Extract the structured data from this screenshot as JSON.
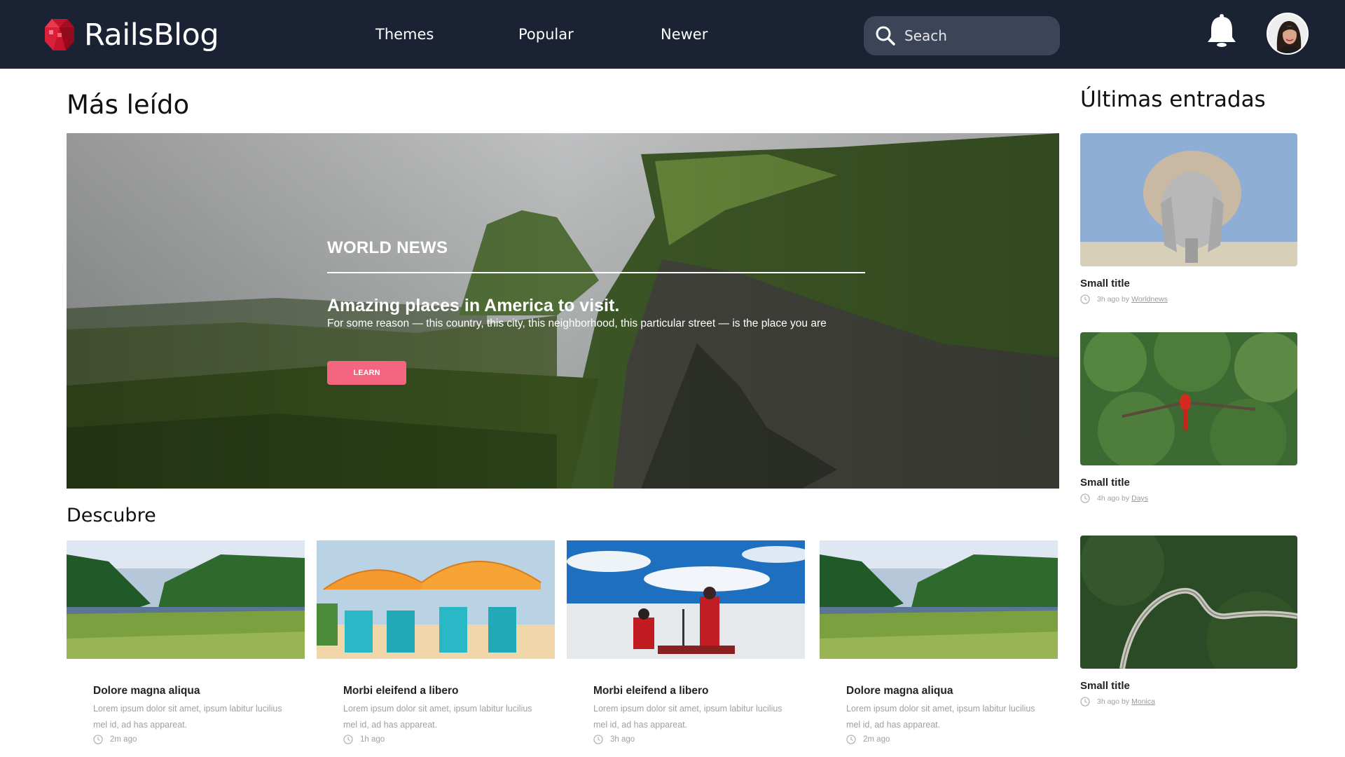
{
  "header": {
    "brand": "RailsBlog",
    "nav": [
      "Themes",
      "Popular",
      "Newer"
    ],
    "search_placeholder": "Seach",
    "colors": {
      "background": "#1a2233",
      "search_background": "#3c4557"
    }
  },
  "sections": {
    "most_read": "Más leído",
    "discover": "Descubre",
    "latest": "Últimas entradas"
  },
  "hero": {
    "category": "WORLD NEWS",
    "title": "Amazing places in America to visit.",
    "description": "For some reason — this country, this city, this neighborhood, this particular street — is the place you are",
    "button": "LEARN",
    "button_color": "#f4657f"
  },
  "cards": [
    {
      "title": "Dolore magna aliqua",
      "excerpt": "Lorem ipsum dolor sit amet, ipsum labitur lucilius mel id, ad has appareat.",
      "time": "2m ago"
    },
    {
      "title": "Morbi eleifend a libero",
      "excerpt": "Lorem ipsum dolor sit amet, ipsum labitur lucilius mel id, ad has appareat.",
      "time": "1h ago"
    },
    {
      "title": "Morbi eleifend a libero",
      "excerpt": "Lorem ipsum dolor sit amet, ipsum labitur lucilius mel id, ad has appareat.",
      "time": "3h ago"
    },
    {
      "title": "Dolore magna aliqua",
      "excerpt": "Lorem ipsum dolor sit amet, ipsum labitur lucilius mel id, ad has appareat.",
      "time": "2m ago"
    }
  ],
  "latest": [
    {
      "title": "Small title",
      "time": "3h ago by",
      "author": "Worldnews"
    },
    {
      "title": "Small title",
      "time": "4h ago by",
      "author": "Days"
    },
    {
      "title": "Small title",
      "time": "3h ago by",
      "author": "Monica"
    }
  ]
}
